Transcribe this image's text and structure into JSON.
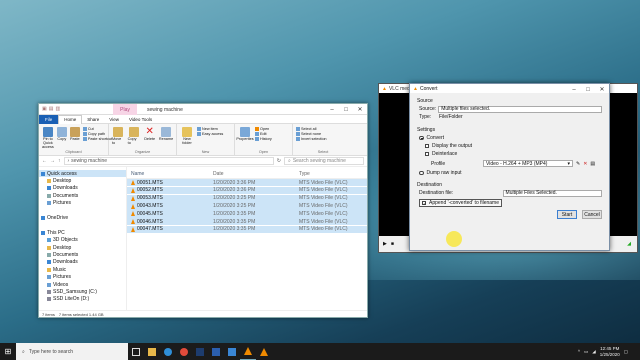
{
  "explorer": {
    "quick_tab": "Play",
    "title": "sewing machine",
    "ribbon_tabs": [
      "File",
      "Home",
      "Share",
      "View",
      "Video Tools"
    ],
    "ribbon": {
      "clipboard": {
        "pin": "Pin to Quick access",
        "copy": "Copy",
        "paste": "Paste",
        "cut": "Cut",
        "copy_path": "Copy path",
        "paste_shortcut": "Paste shortcut",
        "group": "Clipboard"
      },
      "organize": {
        "move": "Move to",
        "copy": "Copy to",
        "delete": "Delete",
        "rename": "Rename",
        "group": "Organize"
      },
      "new": {
        "new_item": "New item",
        "easy_access": "Easy access",
        "new_folder": "New folder",
        "group": "New"
      },
      "open": {
        "properties": "Properties",
        "open": "Open",
        "edit": "Edit",
        "history": "History",
        "group": "Open"
      },
      "select": {
        "select_all": "Select all",
        "select_none": "Select none",
        "invert": "Invert selection",
        "group": "Select"
      }
    },
    "address": "sewing machine",
    "search_placeholder": "Search sewing machine",
    "nav": [
      {
        "label": "Quick access",
        "icon": "star-icon"
      },
      {
        "label": "Desktop",
        "icon": "folder-icon"
      },
      {
        "label": "Downloads",
        "icon": "download-icon"
      },
      {
        "label": "Documents",
        "icon": "document-icon"
      },
      {
        "label": "Pictures",
        "icon": "picture-icon"
      },
      {
        "label": "",
        "icon": ""
      },
      {
        "label": "OneDrive",
        "icon": "cloud-icon"
      },
      {
        "label": "",
        "icon": ""
      },
      {
        "label": "This PC",
        "icon": "pc-icon"
      },
      {
        "label": "3D Objects",
        "icon": "cube-icon"
      },
      {
        "label": "Desktop",
        "icon": "folder-icon"
      },
      {
        "label": "Documents",
        "icon": "document-icon"
      },
      {
        "label": "Downloads",
        "icon": "download-icon"
      },
      {
        "label": "Music",
        "icon": "music-icon"
      },
      {
        "label": "Pictures",
        "icon": "picture-icon"
      },
      {
        "label": "Videos",
        "icon": "video-icon"
      },
      {
        "label": "SSD_Samsung (C:)",
        "icon": "drive-icon"
      },
      {
        "label": "SSD LiteOn (D:)",
        "icon": "drive-icon"
      }
    ],
    "columns": [
      "Name",
      "Date",
      "Type"
    ],
    "files": [
      {
        "name": "00051.MTS",
        "date": "1/20/2020 3:36 PM",
        "type": "MTS Video File (VLC)"
      },
      {
        "name": "00052.MTS",
        "date": "1/20/2020 3:36 PM",
        "type": "MTS Video File (VLC)"
      },
      {
        "name": "00053.MTS",
        "date": "1/20/2020 3:25 PM",
        "type": "MTS Video File (VLC)"
      },
      {
        "name": "00043.MTS",
        "date": "1/20/2020 3:25 PM",
        "type": "MTS Video File (VLC)"
      },
      {
        "name": "00045.MTS",
        "date": "1/20/2020 3:35 PM",
        "type": "MTS Video File (VLC)"
      },
      {
        "name": "00046.MTS",
        "date": "1/20/2020 3:35 PM",
        "type": "MTS Video File (VLC)"
      },
      {
        "name": "00047.MTS",
        "date": "1/20/2020 3:35 PM",
        "type": "MTS Video File (VLC)"
      }
    ],
    "status_count": "7 items",
    "status_selected": "7 items selected  1.44 GB"
  },
  "vlc": {
    "title": "VLC medi"
  },
  "convert": {
    "title": "Convert",
    "source_header": "Source",
    "source_label": "Source:",
    "source_value": "Multiple files selected.",
    "type_label": "Type:",
    "type_value": "File/Folder",
    "settings_header": "Settings",
    "convert_label": "Convert",
    "display_output": "Display the output",
    "deinterlace": "Deinterlace",
    "profile_label": "Profile",
    "profile_value": "Video - H.264 + MP3 (MP4)",
    "dump_raw": "Dump raw input",
    "destination_header": "Destination",
    "dest_file_label": "Destination file:",
    "dest_file_value": "Multiple Files Selected.",
    "append_label": "Append '-converted' to filename",
    "start": "Start",
    "cancel": "Cancel"
  },
  "taskbar": {
    "search_placeholder": "Type here to search",
    "time": "12:45 PM",
    "date": "1/25/2020"
  }
}
